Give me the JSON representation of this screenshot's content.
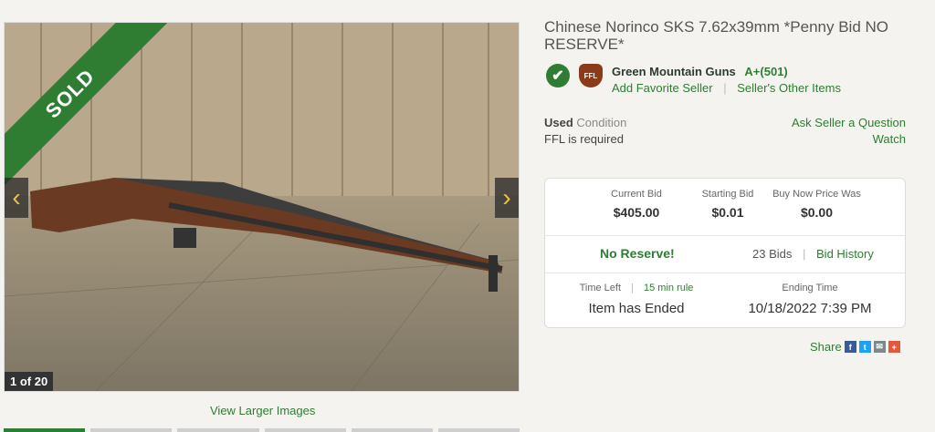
{
  "gallery": {
    "ribbon": "SOLD",
    "counter": "1 of 20",
    "prev_icon": "‹",
    "next_icon": "›",
    "view_larger": "View Larger Images"
  },
  "listing": {
    "title": "Chinese Norinco SKS 7.62x39mm *Penny Bid NO RESERVE*"
  },
  "seller": {
    "badge_ffl": "FFL",
    "name": "Green Mountain Guns",
    "rating": "A+(501)",
    "add_favorite": "Add Favorite Seller",
    "other_items": "Seller's Other Items"
  },
  "condition": {
    "value": "Used",
    "label": "Condition",
    "ffl_note": "FFL is required",
    "ask_seller": "Ask Seller a Question",
    "watch": "Watch"
  },
  "bid": {
    "current_label": "Current Bid",
    "current_value": "$405.00",
    "starting_label": "Starting Bid",
    "starting_value": "$0.01",
    "buynow_label": "Buy Now Price Was",
    "buynow_value": "$0.00",
    "no_reserve": "No Reserve!",
    "bid_count": "23 Bids",
    "bid_history": "Bid History",
    "time_left_label": "Time Left",
    "rule_link": "15 min rule",
    "time_left_value": "Item has Ended",
    "ending_label": "Ending Time",
    "ending_value": "10/18/2022 7:39 PM"
  },
  "share": {
    "label": "Share",
    "icons": [
      "facebook-icon",
      "twitter-icon",
      "email-icon",
      "plus-icon"
    ],
    "colors": {
      "facebook": "#3b5998",
      "twitter": "#1da1f2",
      "email": "#7a8a8a",
      "plus": "#e25a3c"
    }
  },
  "colors": {
    "accent": "#2e7d32",
    "background": "#f4f3ef"
  }
}
